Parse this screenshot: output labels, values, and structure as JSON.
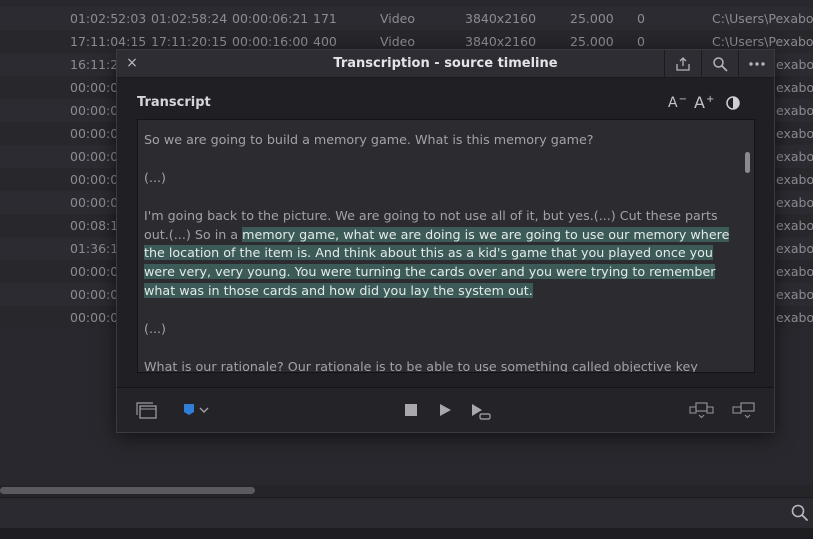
{
  "background_table": {
    "rows": [
      [
        "01:02:52:03",
        "01:02:58:24",
        "00:00:06:21",
        "171",
        "Video",
        "3840x2160",
        "25.000",
        "0",
        "C:\\Users\\Pexabo"
      ],
      [
        "17:11:04:15",
        "17:11:20:15",
        "00:00:16:00",
        "400",
        "Video",
        "3840x2160",
        "25.000",
        "0",
        "C:\\Users\\Pexabo"
      ],
      [
        "16:11:2",
        "",
        "",
        "",
        "",
        "",
        "",
        "",
        "exabo"
      ],
      [
        "00:00:0",
        "",
        "",
        "",
        "",
        "",
        "",
        "",
        "exabo"
      ],
      [
        "00:00:0",
        "",
        "",
        "",
        "",
        "",
        "",
        "",
        "exabo"
      ],
      [
        "00:00:0",
        "",
        "",
        "",
        "",
        "",
        "",
        "",
        "exabo"
      ],
      [
        "00:00:0",
        "",
        "",
        "",
        "",
        "",
        "",
        "",
        "exabo"
      ],
      [
        "00:00:0",
        "",
        "",
        "",
        "",
        "",
        "",
        "",
        "exabo"
      ],
      [
        "00:00:0",
        "",
        "",
        "",
        "",
        "",
        "",
        "",
        "exabo"
      ],
      [
        "00:08:1",
        "",
        "",
        "",
        "",
        "",
        "",
        "",
        "exabo"
      ],
      [
        "01:36:1",
        "",
        "",
        "",
        "",
        "",
        "",
        "",
        "exabo"
      ],
      [
        "00:00:0",
        "",
        "",
        "",
        "",
        "",
        "",
        "",
        "exabo"
      ],
      [
        "00:00:0",
        "",
        "",
        "",
        "",
        "",
        "",
        "",
        "exabo"
      ],
      [
        "00:00:0",
        "",
        "",
        "",
        "",
        "",
        "",
        "",
        "exabo"
      ]
    ]
  },
  "dialog": {
    "title": "Transcription - source timeline",
    "close_label": "×",
    "transcript_label": "Transcript",
    "font_smaller_label": "A",
    "font_smaller_sup": "−",
    "font_larger_label": "A",
    "font_larger_sup": "+",
    "paragraphs": {
      "p1": "So we are going to build a memory game. What is this memory game?",
      "p2": "(...)",
      "p3_before": "I'm going back to the picture. We are going to not use all of it, but yes.(...) Cut these parts out.(...) So in a ",
      "p3_highlight": "memory game, what we are doing is we are going to use our memory where the location of the item is. And think about this as a kid's game that you played once you were very, very young. You were turning the cards over and you were trying to remember what was in those cards and how did you lay the system out. ",
      "p4": "(...)",
      "p5": "What is our rationale? Our rationale is to be able to use something called objective key"
    }
  },
  "colors": {
    "highlight": "#3c5a57",
    "marker": "#2f7fd8",
    "dialog_bg": "#202024",
    "page_bg": "#28282e"
  },
  "icons": {
    "header": [
      "share-icon",
      "search-icon",
      "more-icon"
    ],
    "toolbar": [
      "contrast-icon"
    ],
    "footer": [
      "clips-icon",
      "marker-icon",
      "chevron-down-icon",
      "stop-icon",
      "play-icon",
      "play-from-cursor-icon",
      "insert-clip-icon",
      "append-clip-icon"
    ],
    "page": [
      "search-icon"
    ]
  }
}
